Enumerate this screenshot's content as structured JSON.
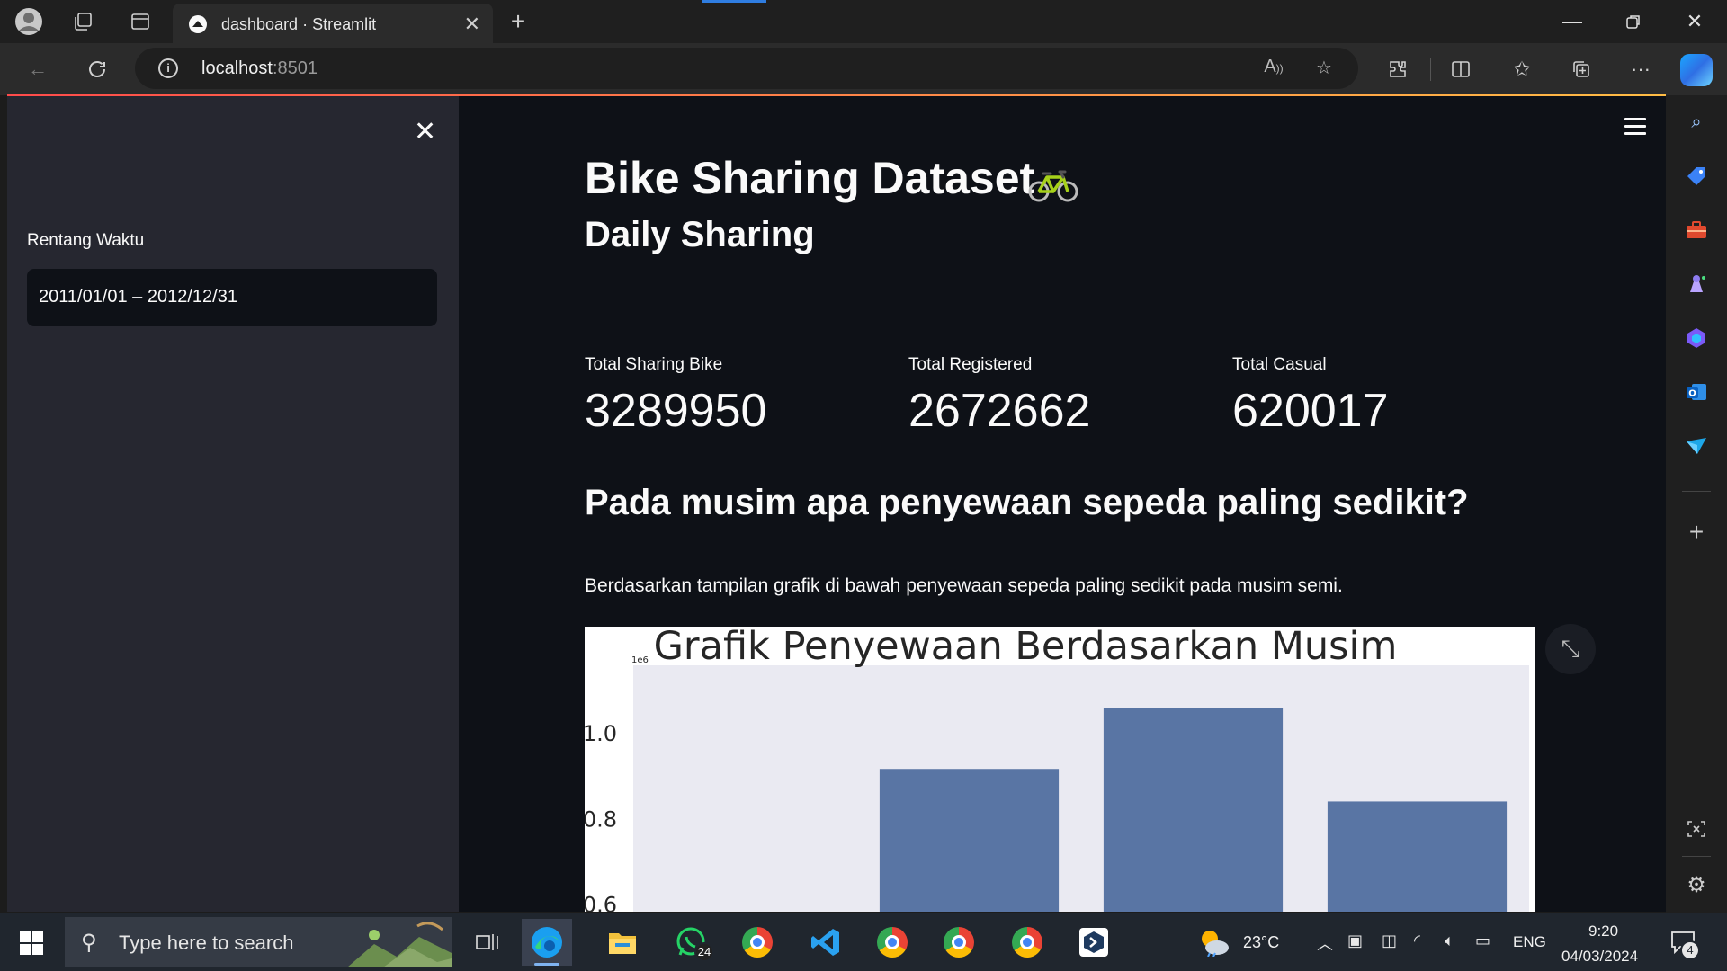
{
  "browser": {
    "tab_title": "dashboard · Streamlit",
    "address_host": "localhost",
    "address_port": ":8501"
  },
  "sidebar": {
    "date_label": "Rentang Waktu",
    "date_value": "2011/01/01 – 2012/12/31"
  },
  "main": {
    "title": "Bike Sharing Dataset",
    "daily_heading": "Daily Sharing",
    "metrics": [
      {
        "label": "Total Sharing Bike",
        "value": "3289950"
      },
      {
        "label": "Total Registered",
        "value": "2672662"
      },
      {
        "label": "Total Casual",
        "value": "620017"
      }
    ],
    "question_heading": "Pada musim apa penyewaan sepeda paling sedikit?",
    "paragraph": "Berdasarkan tampilan grafik di bawah penyewaan sepeda paling sedikit pada musim semi."
  },
  "chart_data": {
    "type": "bar",
    "title": "Grafik Penyewaan Berdasarkan Musim",
    "offset_label": "1e6",
    "y_ticks": [
      "1.0",
      "0.8",
      "0.6"
    ],
    "values": [
      null,
      0.918,
      1.061,
      0.842
    ],
    "ylim": [
      0.53,
      1.16
    ],
    "bar_color": "#5975a4",
    "plot_bg": "#eaeaf2"
  },
  "taskbar": {
    "search_placeholder": "Type here to search",
    "whatsapp_badge": "24",
    "weather": "23°C",
    "language": "ENG",
    "time": "9:20",
    "date": "04/03/2024",
    "notification_count": "4"
  }
}
